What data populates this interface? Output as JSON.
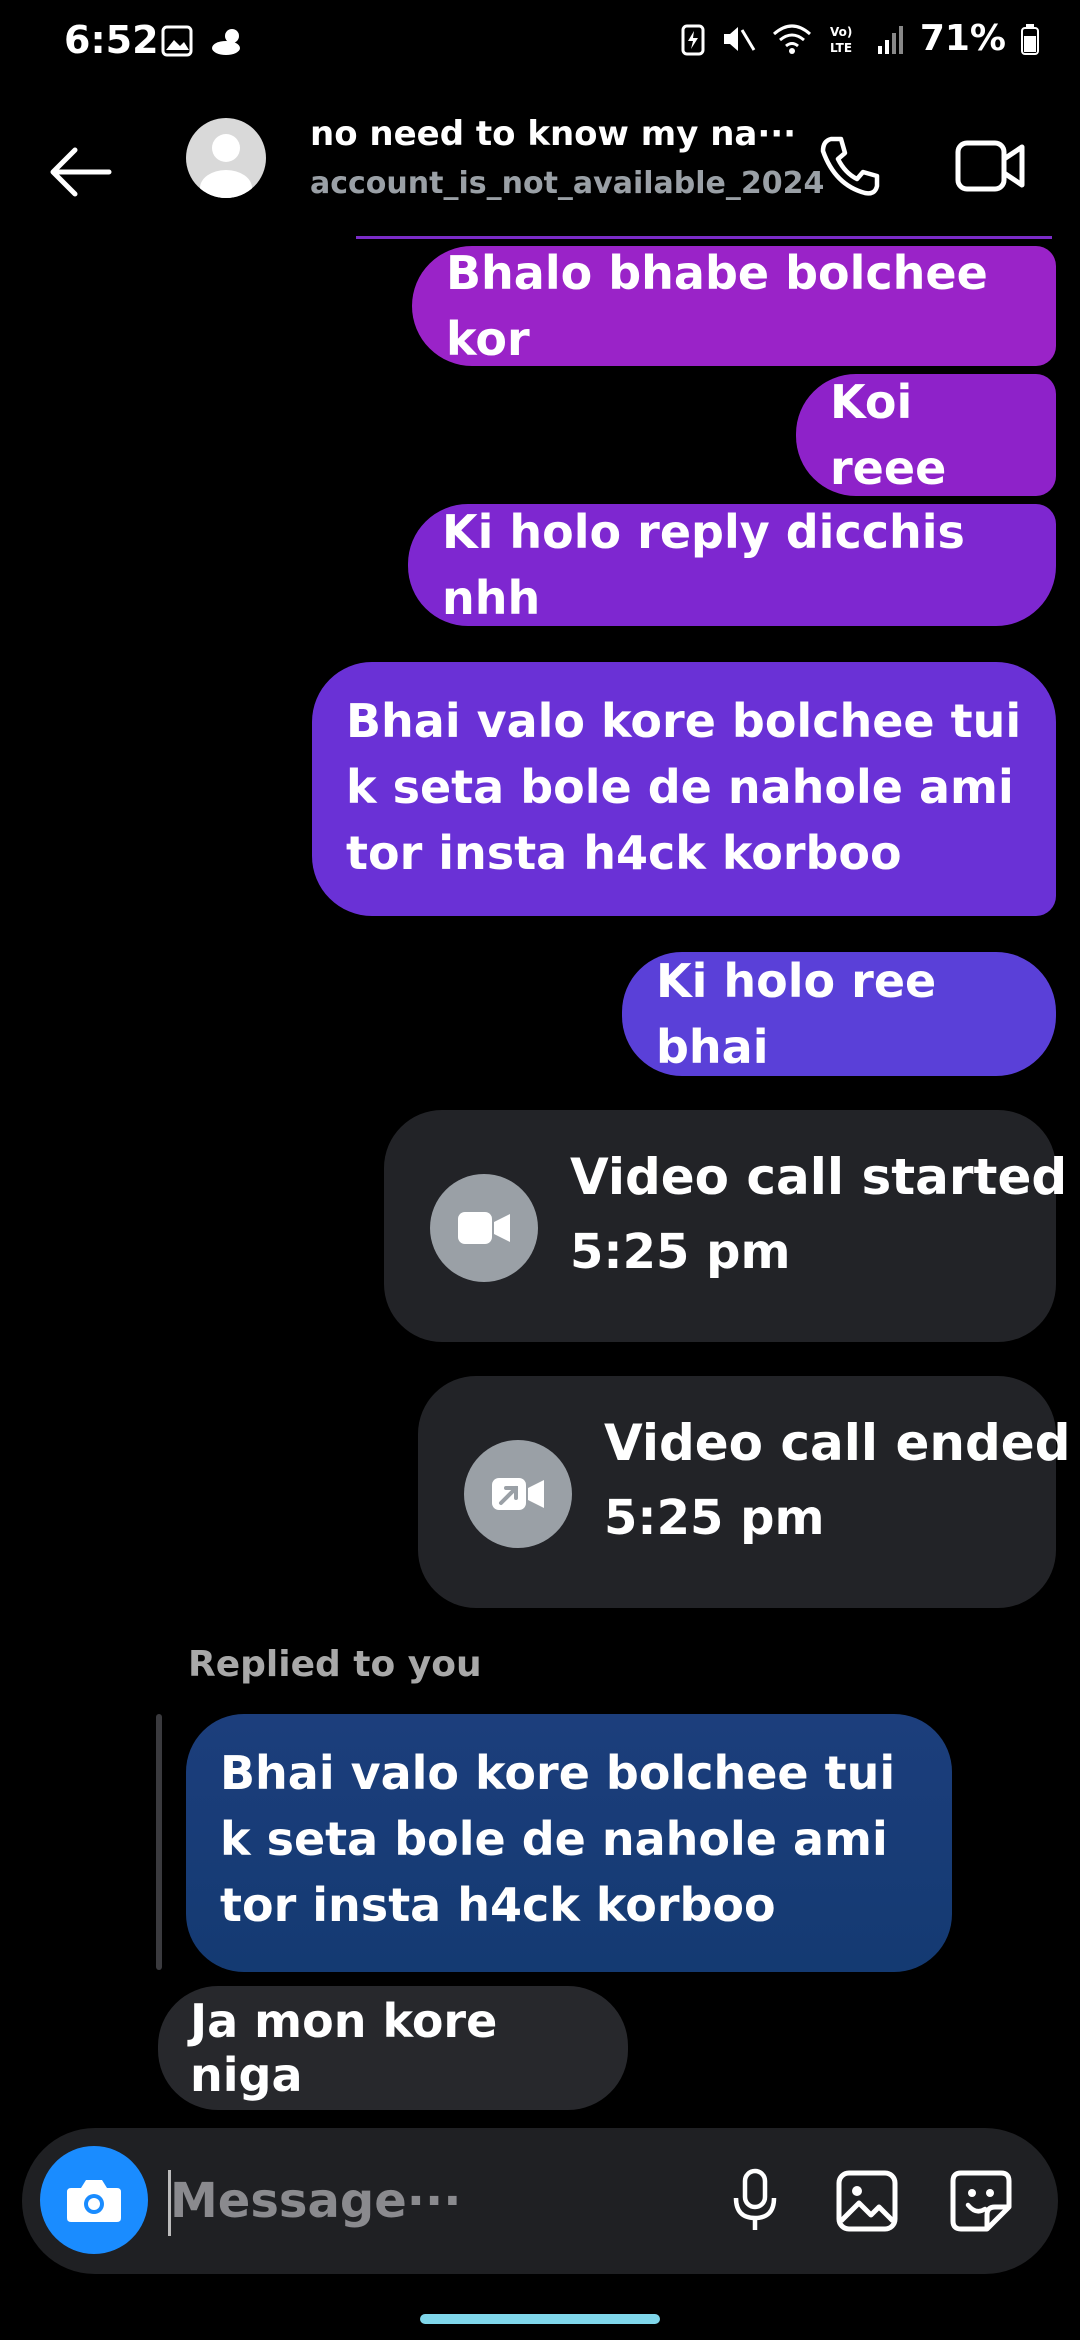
{
  "status_bar": {
    "time": "6:52",
    "battery": "71%"
  },
  "header": {
    "name": "no need to know my na···",
    "username": "account_is_not_available_2024"
  },
  "messages": [
    {
      "text": "Bhalo bhabe bolchee kor"
    },
    {
      "text": "Koi reee"
    },
    {
      "text": "Ki holo reply dicchis nhh"
    },
    {
      "text": "Bhai valo kore bolchee tui k seta bole de nahole ami tor insta h4ck korboo"
    },
    {
      "text": "Ki holo ree bhai"
    }
  ],
  "calls": [
    {
      "title": "Video call started",
      "time": "5:25 pm"
    },
    {
      "title": "Video call ended",
      "time": "5:25 pm"
    }
  ],
  "reply": {
    "label": "Replied to you",
    "quoted": "Bhai valo kore bolchee tui k seta bole de nahole ami tor insta h4ck korboo",
    "text": "Ja mon kore niga"
  },
  "composer": {
    "placeholder": "Message···"
  },
  "colors": {
    "camera": "#1a8cff",
    "reply_bubble": "#1c3e7c",
    "sent_top": "#9a23c8",
    "sent_bottom": "#5a40d8"
  },
  "icons": [
    "back-arrow-icon",
    "avatar-icon",
    "phone-icon",
    "video-icon",
    "camera-icon",
    "mic-icon",
    "image-icon",
    "sticker-icon"
  ]
}
